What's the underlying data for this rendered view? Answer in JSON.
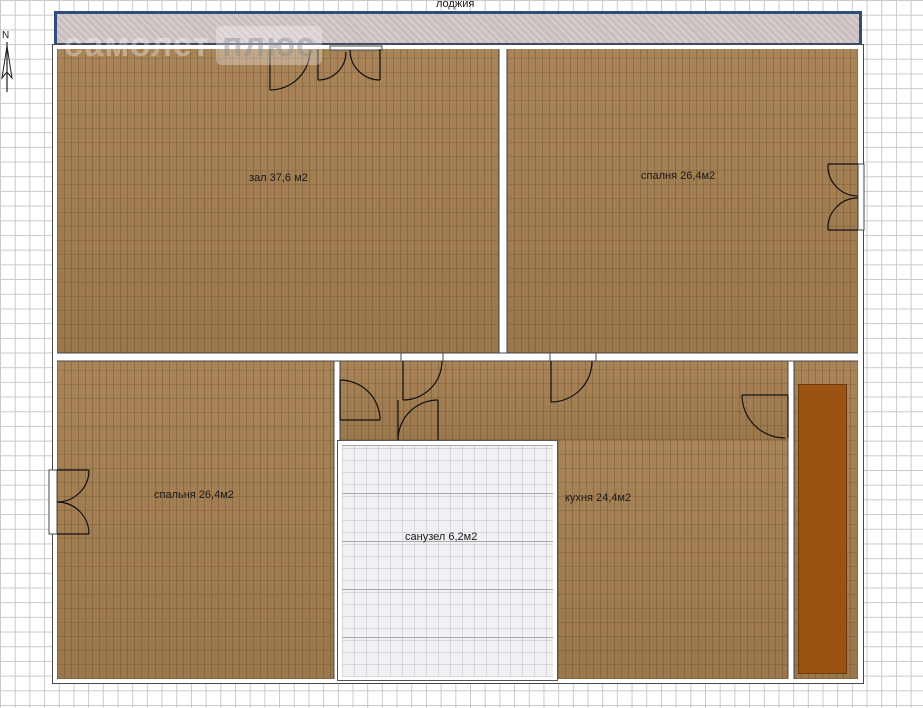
{
  "plan": {
    "loggia_label": "лоджия",
    "compass_letter": "N",
    "watermark": {
      "brand": "самолет",
      "tag": "плюс"
    },
    "rooms": {
      "hall": "зал 37,6 м2",
      "bedroom_top": "спалня 26,4м2",
      "bedroom_left": "спальня 26,4м2",
      "bathroom": "санузел 6,2м2",
      "kitchen": "кухня 24,4м2"
    }
  },
  "colors": {
    "floor": "#a27e52",
    "tile": "#f1f1f3",
    "wall": "#ffffff",
    "loggia_border": "#2f4f7a",
    "cabinet": "#9b5314"
  }
}
